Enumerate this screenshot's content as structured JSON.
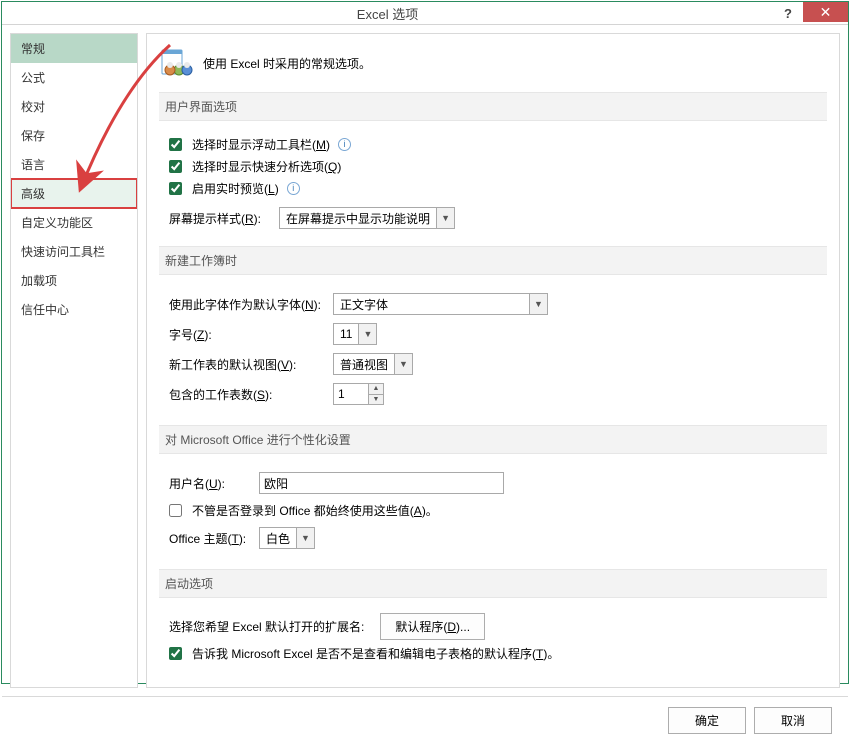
{
  "window": {
    "title": "Excel 选项",
    "help": "?",
    "close": "✕"
  },
  "sidebar": {
    "items": [
      {
        "label": "常规"
      },
      {
        "label": "公式"
      },
      {
        "label": "校对"
      },
      {
        "label": "保存"
      },
      {
        "label": "语言"
      },
      {
        "label": "高级"
      },
      {
        "label": "自定义功能区"
      },
      {
        "label": "快速访问工具栏"
      },
      {
        "label": "加载项"
      },
      {
        "label": "信任中心"
      }
    ]
  },
  "intro": {
    "text": "使用 Excel 时采用的常规选项。"
  },
  "sections": {
    "ui": {
      "header": "用户界面选项",
      "cb_float_toolbar": "选择时显示浮动工具栏(M)",
      "cb_quick_analysis": "选择时显示快速分析选项(Q)",
      "cb_live_preview": "启用实时预览(L)",
      "screentip_label": "屏幕提示样式(R):",
      "screentip_value": "在屏幕提示中显示功能说明"
    },
    "newwb": {
      "header": "新建工作簿时",
      "default_font_label": "使用此字体作为默认字体(N):",
      "default_font_value": "正文字体",
      "font_size_label": "字号(Z):",
      "font_size_value": "11",
      "default_view_label": "新工作表的默认视图(V):",
      "default_view_value": "普通视图",
      "sheet_count_label": "包含的工作表数(S):",
      "sheet_count_value": "1"
    },
    "personalize": {
      "header": "对 Microsoft Office 进行个性化设置",
      "username_label": "用户名(U):",
      "username_value": "欧阳",
      "cb_always_use": "不管是否登录到 Office 都始终使用这些值(A)。",
      "theme_label": "Office 主题(T):",
      "theme_value": "白色"
    },
    "startup": {
      "header": "启动选项",
      "ext_label": "选择您希望 Excel 默认打开的扩展名:",
      "ext_button": "默认程序(D)...",
      "cb_tell_me": "告诉我 Microsoft Excel 是否不是查看和编辑电子表格的默认程序(T)。"
    }
  },
  "footer": {
    "ok": "确定",
    "cancel": "取消"
  }
}
